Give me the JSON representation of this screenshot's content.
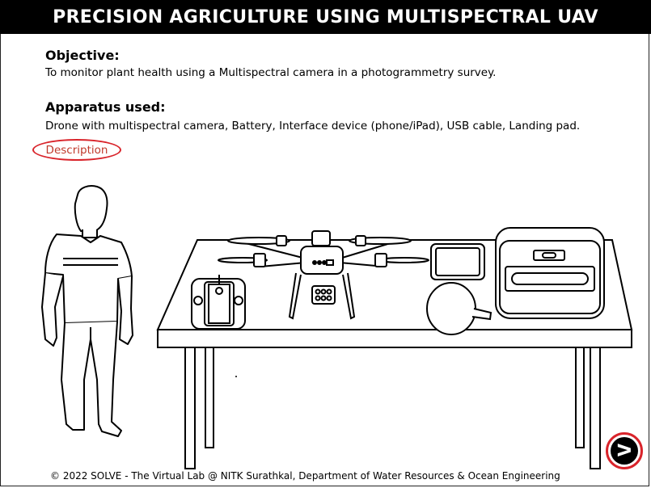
{
  "header": {
    "title": "PRECISION AGRICULTURE USING MULTISPECTRAL UAV"
  },
  "objective": {
    "heading": "Objective:",
    "text": "To monitor plant health using a Multispectral camera in a photogrammetry survey."
  },
  "apparatus": {
    "heading": "Apparatus used:",
    "text": "Drone with multispectral camera, Battery, Interface device (phone/iPad), USB cable, Landing pad."
  },
  "description_button": {
    "label": "Description"
  },
  "next_button": {
    "label": "ᐳ",
    "icon": "next-arrow-icon"
  },
  "footer": {
    "text": "© 2022 SOLVE - The Virtual Lab @ NITK Surathkal, Department of Water Resources & Ocean Engineering"
  },
  "colors": {
    "title_bg": "#000000",
    "accent": "#d9242b"
  }
}
